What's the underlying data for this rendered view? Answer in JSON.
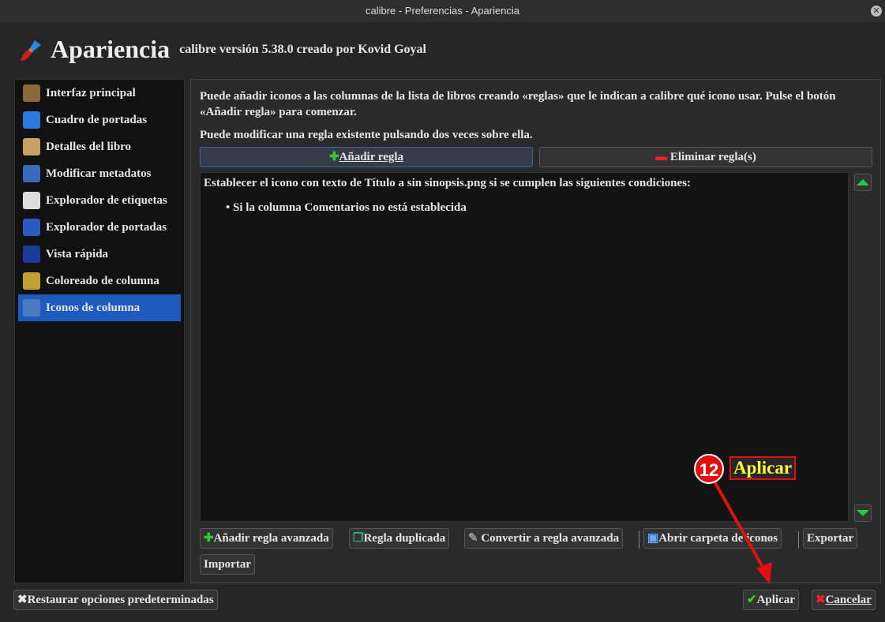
{
  "window": {
    "title": "calibre - Preferencias - Apariencia"
  },
  "header": {
    "title": "Apariencia",
    "subtitle": "calibre versión 5.38.0 creado por Kovid Goyal"
  },
  "sidebar": {
    "items": [
      {
        "label": "Interfaz principal",
        "icon": "books-icon"
      },
      {
        "label": "Cuadro de portadas",
        "icon": "grid-icon"
      },
      {
        "label": "Detalles del libro",
        "icon": "book-icon"
      },
      {
        "label": "Modificar metadatos",
        "icon": "edit-icon"
      },
      {
        "label": "Explorador de etiquetas",
        "icon": "tag-icon"
      },
      {
        "label": "Explorador de portadas",
        "icon": "cover-browser-icon"
      },
      {
        "label": "Vista rápida",
        "icon": "quickview-icon"
      },
      {
        "label": "Coloreado de columna",
        "icon": "color-icon"
      },
      {
        "label": "Iconos de columna",
        "icon": "column-icons-icon",
        "selected": true
      }
    ]
  },
  "main": {
    "intro": "Puede añadir iconos a las columnas de la lista de libros creando «reglas» que le indican a calibre qué icono usar. Pulse el botón «Añadir regla» para comenzar.",
    "hint": "Puede modificar una regla existente pulsando dos veces sobre ella.",
    "add_rule": "Añadir regla",
    "remove_rule": "Eliminar regla(s)",
    "rule": {
      "title": "Establecer el icono con texto de Título a sin sinopsis.png si se cumplen las siguientes condiciones:",
      "conditions": [
        "Si la columna Comentarios no está establecida"
      ]
    },
    "buttons": {
      "add_advanced": "Añadir regla avanzada",
      "duplicate": "Regla duplicada",
      "convert": "Convertir a regla avanzada",
      "open_folder": "Abrir carpeta de iconos",
      "export": "Exportar",
      "import": "Importar"
    }
  },
  "footer": {
    "restore": "Restaurar opciones predeterminadas",
    "apply": "Aplicar",
    "cancel": "Cancelar"
  },
  "annotation": {
    "step": "12",
    "label": "Aplicar",
    "color": "#e01010"
  }
}
